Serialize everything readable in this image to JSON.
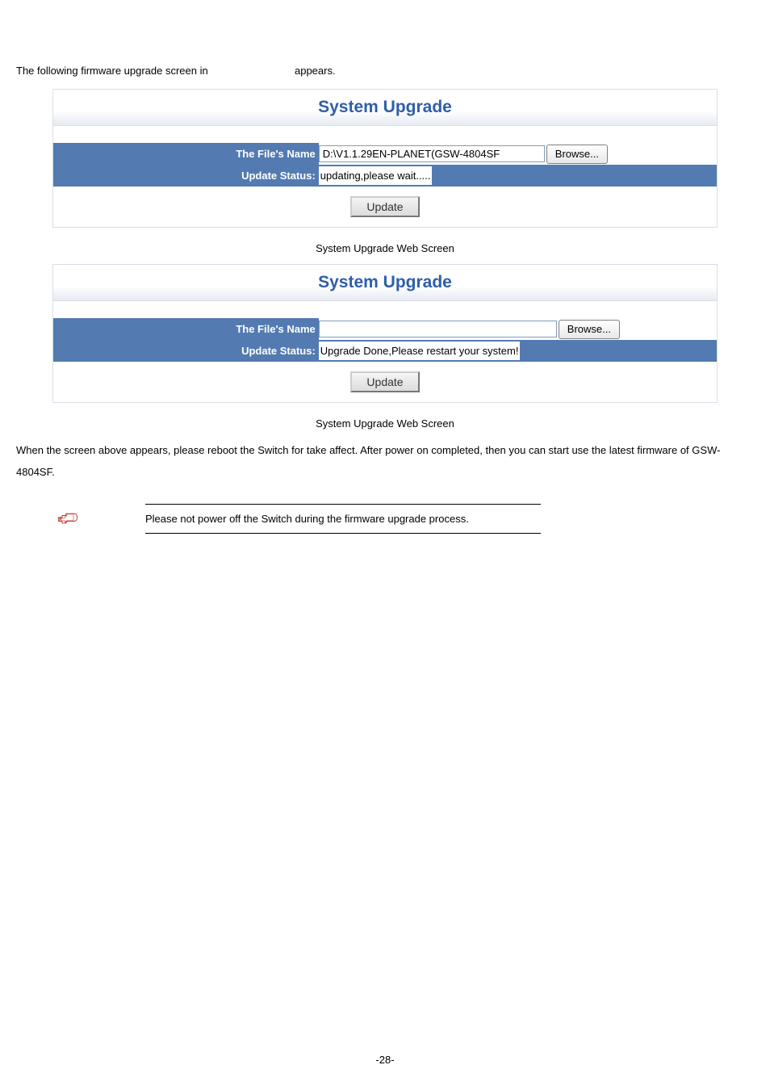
{
  "intro_prefix": "The following firmware upgrade screen in",
  "intro_suffix": "appears.",
  "panel1": {
    "title": "System Upgrade",
    "file_label": "The File's Name",
    "file_value": "D:\\V1.1.29EN-PLANET(GSW-4804SF",
    "browse_label": "Browse...",
    "status_label": "Update Status:",
    "status_value": "updating,please wait.....",
    "update_label": "Update"
  },
  "caption1": "System Upgrade Web Screen",
  "panel2": {
    "title": "System Upgrade",
    "file_label": "The File's Name",
    "file_value": "",
    "browse_label": "Browse...",
    "status_label": "Update Status:",
    "status_value": "Upgrade Done,Please restart your system!",
    "update_label": "Update"
  },
  "caption2": "System Upgrade Web Screen",
  "body_text": "When the screen above appears, please reboot the Switch for take affect. After power on completed, then you can start use the latest firmware of GSW-4804SF.",
  "note_text": "Please not power off the Switch during the firmware upgrade process.",
  "page_number": "-28-"
}
